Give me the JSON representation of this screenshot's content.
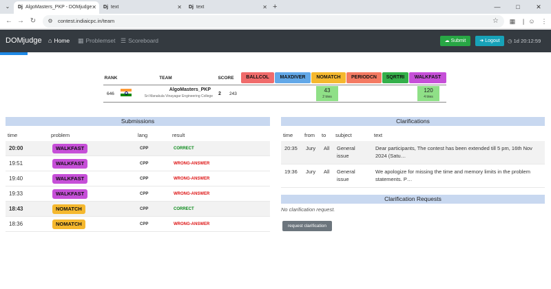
{
  "browser": {
    "tabs": [
      {
        "favicon": "Dj",
        "title": "AlgoMasters_PKP - DOMjudge",
        "active": true
      },
      {
        "favicon": "Dj",
        "title": "text",
        "active": false
      },
      {
        "favicon": "Dj",
        "title": "text",
        "active": false
      }
    ],
    "url": "contest.indiaicpc.in/team",
    "icons": {
      "menu": "chevron-down-icon",
      "back": "back-arrow-icon",
      "forward": "forward-arrow-icon",
      "reload": "reload-icon",
      "site": "site-info-icon",
      "star": "star-icon"
    }
  },
  "navbar": {
    "brand": "DOMjudge",
    "links": {
      "home": "Home",
      "problemset": "Problemset",
      "scoreboard": "Scoreboard"
    },
    "submit": "Submit",
    "logout": "Logout",
    "timer": "1d 20:12:59"
  },
  "scoreboard": {
    "headers": {
      "rank": "RANK",
      "team": "TEAM",
      "score": "SCORE"
    },
    "problems": [
      {
        "label": "BALLCOL",
        "color": "#f06b6b"
      },
      {
        "label": "MAXDIVER",
        "color": "#62a8e8"
      },
      {
        "label": "NOMATCH",
        "color": "#f5b82e"
      },
      {
        "label": "PERIODCN",
        "color": "#f47a62"
      },
      {
        "label": "SQRTRI",
        "color": "#34b04a"
      },
      {
        "label": "WALKFAST",
        "color": "#c64fd8"
      }
    ],
    "row": {
      "rank": "646",
      "team_name": "AlgoMasters_PKP",
      "affiliation": "Sri Manakula Vinayagar Engineering College",
      "solved": "2",
      "penalty": "243",
      "cells": [
        {
          "problem": "NOMATCH",
          "value": "43",
          "tries": "2 tries"
        },
        {
          "problem": "WALKFAST",
          "value": "120",
          "tries": "4 tries"
        }
      ]
    },
    "solved_color": "#8fe087"
  },
  "submissions": {
    "title": "Submissions",
    "columns": {
      "time": "time",
      "problem": "problem",
      "lang": "lang",
      "result": "result"
    },
    "rows": [
      {
        "time": "20:00",
        "problem": "WALKFAST",
        "lang": "CPP",
        "result": "CORRECT"
      },
      {
        "time": "19:51",
        "problem": "WALKFAST",
        "lang": "CPP",
        "result": "WRONG-ANSWER"
      },
      {
        "time": "19:40",
        "problem": "WALKFAST",
        "lang": "CPP",
        "result": "WRONG-ANSWER"
      },
      {
        "time": "19:33",
        "problem": "WALKFAST",
        "lang": "CPP",
        "result": "WRONG-ANSWER"
      },
      {
        "time": "18:43",
        "problem": "NOMATCH",
        "lang": "CPP",
        "result": "CORRECT"
      },
      {
        "time": "18:36",
        "problem": "NOMATCH",
        "lang": "CPP",
        "result": "WRONG-ANSWER"
      }
    ],
    "badge_colors": {
      "WALKFAST": "#c64fd8",
      "NOMATCH": "#f5b82e"
    },
    "result_colors": {
      "CORRECT": "#0a8a1a",
      "WRONG-ANSWER": "#dd1111"
    }
  },
  "clarifications": {
    "title": "Clarifications",
    "columns": {
      "time": "time",
      "from": "from",
      "to": "to",
      "subject": "subject",
      "text": "text"
    },
    "rows": [
      {
        "time": "20:35",
        "from": "Jury",
        "to": "All",
        "subject": "General issue",
        "text": "Dear participants, The contest has been extended till 5 pm, 16th Nov 2024 (Satu…"
      },
      {
        "time": "19:36",
        "from": "Jury",
        "to": "All",
        "subject": "General issue",
        "text": "We apologize for missing the time and memory limits in the problem statements. P…"
      }
    ]
  },
  "clarification_requests": {
    "title": "Clarification Requests",
    "empty_text": "No clarification request.",
    "button": "request clarification"
  }
}
